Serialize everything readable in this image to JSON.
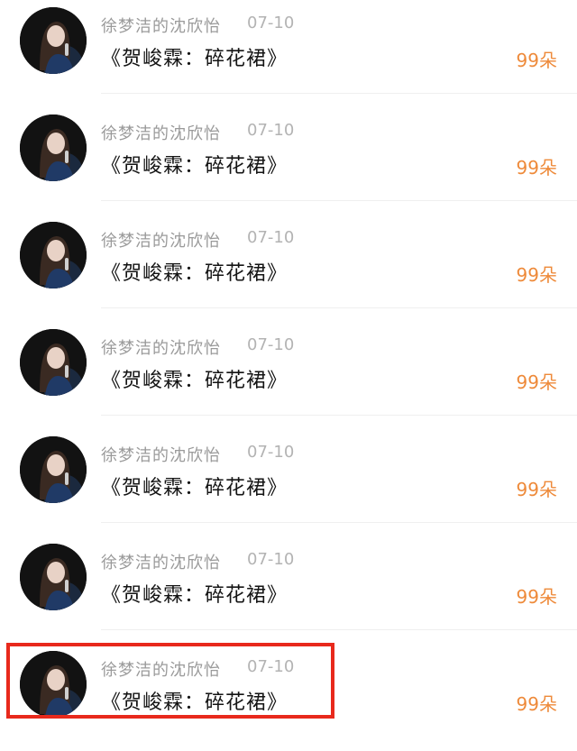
{
  "items": [
    {
      "author": "徐梦洁的沈欣怡",
      "date": "07-10",
      "title": "《贺峻霖：碎花裙》",
      "gifts": "99朵"
    },
    {
      "author": "徐梦洁的沈欣怡",
      "date": "07-10",
      "title": "《贺峻霖：碎花裙》",
      "gifts": "99朵"
    },
    {
      "author": "徐梦洁的沈欣怡",
      "date": "07-10",
      "title": "《贺峻霖：碎花裙》",
      "gifts": "99朵"
    },
    {
      "author": "徐梦洁的沈欣怡",
      "date": "07-10",
      "title": "《贺峻霖：碎花裙》",
      "gifts": "99朵"
    },
    {
      "author": "徐梦洁的沈欣怡",
      "date": "07-10",
      "title": "《贺峻霖：碎花裙》",
      "gifts": "99朵"
    },
    {
      "author": "徐梦洁的沈欣怡",
      "date": "07-10",
      "title": "《贺峻霖：碎花裙》",
      "gifts": "99朵"
    },
    {
      "author": "徐梦洁的沈欣怡",
      "date": "07-10",
      "title": "《贺峻霖：碎花裙》",
      "gifts": "99朵"
    }
  ],
  "colors": {
    "author": "#9a9a9a",
    "date": "#b3b3b3",
    "title": "#141414",
    "gift_count": "#ee8a3a",
    "highlight_border": "#e8291c"
  },
  "icons": {
    "avatar": "user-avatar-photo"
  }
}
